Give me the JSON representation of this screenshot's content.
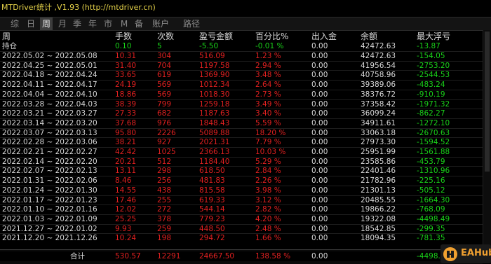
{
  "title": "MTDriver统计 ,V1.93 (http://mtdriver.cn)",
  "tabs": [
    "综",
    "日",
    "周",
    "月",
    "季",
    "年",
    "市",
    "M",
    "备",
    "账户",
    "路径"
  ],
  "active_tab": "周",
  "columns": [
    "周",
    "手数",
    "次数",
    "盈亏金额",
    "百分比%",
    "出入金",
    "余额",
    "最大浮亏"
  ],
  "position": {
    "label": "持仓",
    "lots": "0.10",
    "count": "5",
    "pnl": "-5.50",
    "pct": "-0.01 %",
    "deposit": "0.00",
    "balance": "42472.63",
    "max_dd": "-13.87"
  },
  "rows": [
    {
      "period": "2022.05.02 ~ 2022.05.08",
      "lots": "10.31",
      "count": "304",
      "pnl": "516.09",
      "pct": "1.23 %",
      "deposit": "0.00",
      "balance": "42472.63",
      "max_dd": "-154.05"
    },
    {
      "period": "2022.04.25 ~ 2022.05.01",
      "lots": "31.40",
      "count": "704",
      "pnl": "1197.58",
      "pct": "2.94 %",
      "deposit": "0.00",
      "balance": "41956.54",
      "max_dd": "-2753.20"
    },
    {
      "period": "2022.04.18 ~ 2022.04.24",
      "lots": "33.65",
      "count": "619",
      "pnl": "1369.90",
      "pct": "3.48 %",
      "deposit": "0.00",
      "balance": "40758.96",
      "max_dd": "-2544.53"
    },
    {
      "period": "2022.04.11 ~ 2022.04.17",
      "lots": "24.19",
      "count": "569",
      "pnl": "1012.34",
      "pct": "2.64 %",
      "deposit": "0.00",
      "balance": "39389.06",
      "max_dd": "-483.24"
    },
    {
      "period": "2022.04.04 ~ 2022.04.10",
      "lots": "18.86",
      "count": "569",
      "pnl": "1018.30",
      "pct": "2.73 %",
      "deposit": "0.00",
      "balance": "38376.72",
      "max_dd": "-910.19"
    },
    {
      "period": "2022.03.28 ~ 2022.04.03",
      "lots": "38.39",
      "count": "799",
      "pnl": "1259.18",
      "pct": "3.49 %",
      "deposit": "0.00",
      "balance": "37358.42",
      "max_dd": "-1971.32"
    },
    {
      "period": "2022.03.21 ~ 2022.03.27",
      "lots": "27.33",
      "count": "682",
      "pnl": "1187.63",
      "pct": "3.40 %",
      "deposit": "0.00",
      "balance": "36099.24",
      "max_dd": "-862.27"
    },
    {
      "period": "2022.03.14 ~ 2022.03.20",
      "lots": "37.68",
      "count": "976",
      "pnl": "1848.43",
      "pct": "5.59 %",
      "deposit": "0.00",
      "balance": "34911.61",
      "max_dd": "-1272.10"
    },
    {
      "period": "2022.03.07 ~ 2022.03.13",
      "lots": "95.80",
      "count": "2226",
      "pnl": "5089.88",
      "pct": "18.20 %",
      "deposit": "0.00",
      "balance": "33063.18",
      "max_dd": "-2670.63"
    },
    {
      "period": "2022.02.28 ~ 2022.03.06",
      "lots": "38.21",
      "count": "927",
      "pnl": "2021.31",
      "pct": "7.79 %",
      "deposit": "0.00",
      "balance": "27973.30",
      "max_dd": "-1594.52"
    },
    {
      "period": "2022.02.21 ~ 2022.02.27",
      "lots": "42.42",
      "count": "1025",
      "pnl": "2366.13",
      "pct": "10.03 %",
      "deposit": "0.00",
      "balance": "25951.99",
      "max_dd": "-1561.88"
    },
    {
      "period": "2022.02.14 ~ 2022.02.20",
      "lots": "20.21",
      "count": "512",
      "pnl": "1184.40",
      "pct": "5.29 %",
      "deposit": "0.00",
      "balance": "23585.86",
      "max_dd": "-453.79"
    },
    {
      "period": "2022.02.07 ~ 2022.02.13",
      "lots": "13.11",
      "count": "298",
      "pnl": "618.50",
      "pct": "2.84 %",
      "deposit": "0.00",
      "balance": "22401.46",
      "max_dd": "-1310.96"
    },
    {
      "period": "2022.01.31 ~ 2022.02.06",
      "lots": "8.46",
      "count": "256",
      "pnl": "481.83",
      "pct": "2.26 %",
      "deposit": "0.00",
      "balance": "21782.96",
      "max_dd": "-225.16"
    },
    {
      "period": "2022.01.24 ~ 2022.01.30",
      "lots": "14.55",
      "count": "438",
      "pnl": "815.58",
      "pct": "3.98 %",
      "deposit": "0.00",
      "balance": "21301.13",
      "max_dd": "-505.12"
    },
    {
      "period": "2022.01.17 ~ 2022.01.23",
      "lots": "17.46",
      "count": "255",
      "pnl": "619.33",
      "pct": "3.12 %",
      "deposit": "0.00",
      "balance": "20485.55",
      "max_dd": "-1664.30"
    },
    {
      "period": "2022.01.10 ~ 2022.01.16",
      "lots": "12.02",
      "count": "272",
      "pnl": "544.14",
      "pct": "2.82 %",
      "deposit": "0.00",
      "balance": "19866.22",
      "max_dd": "-768.09"
    },
    {
      "period": "2022.01.03 ~ 2022.01.09",
      "lots": "25.25",
      "count": "378",
      "pnl": "779.23",
      "pct": "4.20 %",
      "deposit": "0.00",
      "balance": "19322.08",
      "max_dd": "-4498.49"
    },
    {
      "period": "2021.12.27 ~ 2022.01.02",
      "lots": "9.93",
      "count": "259",
      "pnl": "448.50",
      "pct": "2.48 %",
      "deposit": "0.00",
      "balance": "18542.85",
      "max_dd": "-299.35"
    },
    {
      "period": "2021.12.20 ~ 2021.12.26",
      "lots": "10.24",
      "count": "198",
      "pnl": "294.72",
      "pct": "1.66 %",
      "deposit": "0.00",
      "balance": "18094.35",
      "max_dd": "-781.35"
    }
  ],
  "totals": {
    "label": "合计",
    "lots": "530.57",
    "count": "12291",
    "pnl": "24667.50",
    "pct": "138.58 %",
    "deposit": "0.00",
    "max_dd": "-4498.49"
  },
  "badge": {
    "text": "EAHub",
    "icon": "eahub-logo-icon"
  },
  "colors": {
    "title": "#e6d34a",
    "positive": "#e02020",
    "negative": "#19d119",
    "neutral": "#d8d8d8",
    "background": "#000000"
  }
}
